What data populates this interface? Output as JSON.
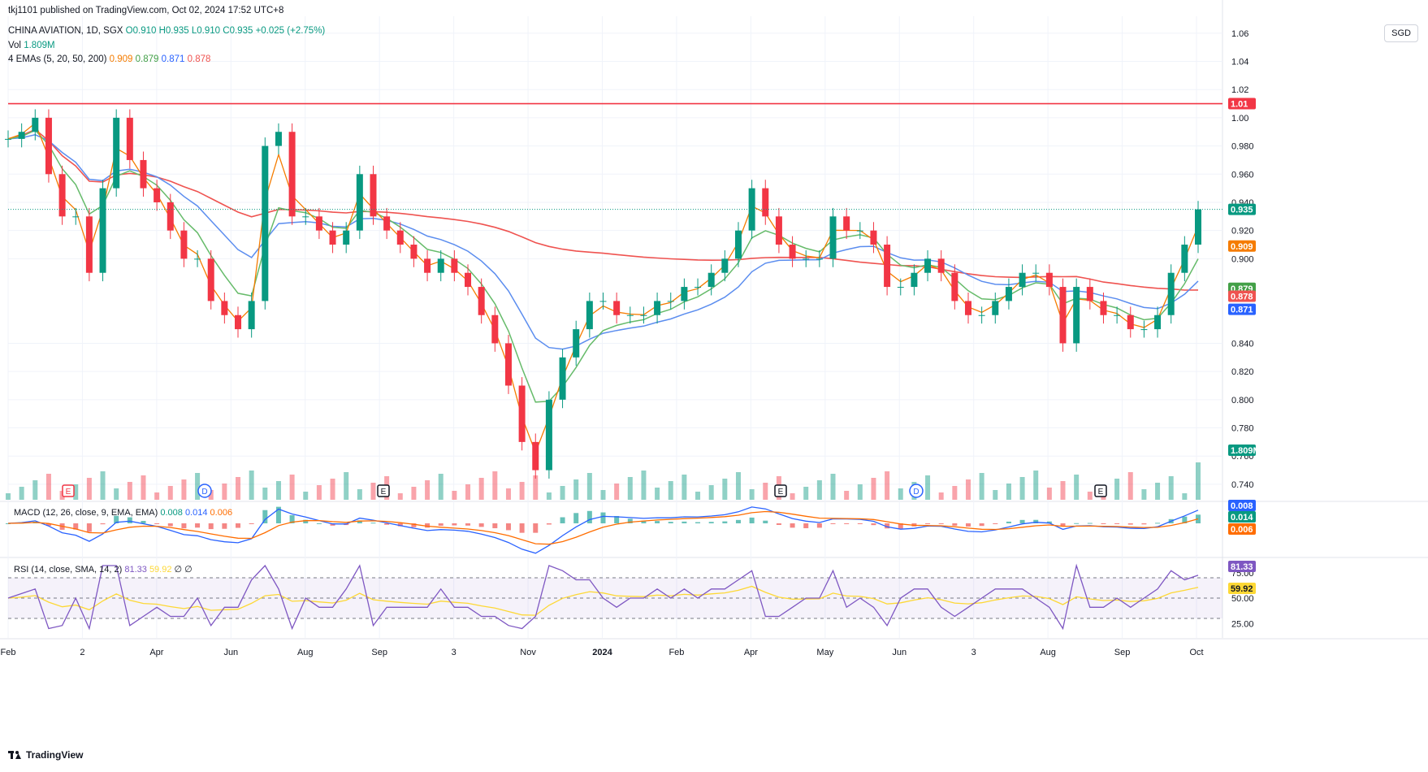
{
  "publisher": "tkj1101 published on TradingView.com, Oct 02, 2024 17:52 UTC+8",
  "currency": "SGD",
  "brand": "TradingView",
  "symbol_line": {
    "symbol": "CHINA AVIATION, 1D, SGX",
    "o": "O0.910",
    "h": "H0.935",
    "l": "L0.910",
    "c": "C0.935",
    "chg": "+0.025 (+2.75%)"
  },
  "vol_line": {
    "label": "Vol",
    "value": "1.809M"
  },
  "ema_line": {
    "label": "4 EMAs (5, 20, 50, 200)",
    "v1": "0.909",
    "v2": "0.879",
    "v3": "0.871",
    "v4": "0.878"
  },
  "macd_line": {
    "label": "MACD (12, 26, close, 9, EMA, EMA)",
    "v1": "0.008",
    "v2": "0.014",
    "v3": "0.006"
  },
  "rsi_line": {
    "label": "RSI (14, close, SMA, 14, 2)",
    "v1": "81.33",
    "v2": "59.92",
    "v3": "∅ ∅"
  },
  "colors": {
    "up": "#089981",
    "down": "#f23645",
    "ema5": "#f57c00",
    "ema20": "#66bb6a",
    "ema50": "#5b8def",
    "ema200": "#ef5350",
    "macd": "#2962ff",
    "signal": "#ff6d00",
    "rsi": "#7e57c2",
    "rsi_ma": "#fdd835",
    "hline": "#f23645"
  },
  "chart_data": {
    "type": "candlestick",
    "y_ticks": [
      "1.06",
      "1.04",
      "1.02",
      "1.00",
      "0.980",
      "0.960",
      "0.940",
      "0.920",
      "0.900",
      "0.840",
      "0.820",
      "0.800",
      "0.780",
      "0.760",
      "0.740"
    ],
    "ylim": [
      0.729,
      1.072
    ],
    "x_ticks": [
      "Feb",
      "2",
      "Apr",
      "Jun",
      "Aug",
      "Sep",
      "3",
      "Nov",
      "2024",
      "Feb",
      "Apr",
      "May",
      "Jun",
      "3",
      "Aug",
      "Sep",
      "Oct"
    ],
    "horizontal_line": {
      "value": 1.01,
      "label": "1.01"
    },
    "last_price": {
      "value": 0.935,
      "label": "0.935"
    },
    "price_labels": [
      {
        "value": 0.909,
        "label": "0.909",
        "color": "#f57c00"
      },
      {
        "value": 0.879,
        "label": "0.879",
        "color": "#43a047"
      },
      {
        "value": 0.878,
        "label": "0.878",
        "color": "#ef5350"
      },
      {
        "value": 0.871,
        "label": "0.871",
        "color": "#2962ff"
      }
    ],
    "volume_label": "1.809M",
    "events": [
      {
        "x": "Feb",
        "letter": "E",
        "color": "#f23645"
      },
      {
        "x": "Apr",
        "letter": "D",
        "color": "#2962ff"
      },
      {
        "x": "Aug",
        "letter": "E",
        "color": "#131722"
      },
      {
        "x": "Feb",
        "letter": "E",
        "color": "#131722"
      },
      {
        "x": "May",
        "letter": "D",
        "color": "#2962ff"
      },
      {
        "x": "Aug",
        "letter": "E",
        "color": "#131722"
      }
    ],
    "close_series": [
      0.985,
      0.99,
      1.0,
      0.96,
      0.93,
      0.93,
      0.89,
      0.95,
      1.0,
      0.97,
      0.95,
      0.94,
      0.92,
      0.9,
      0.9,
      0.87,
      0.86,
      0.85,
      0.87,
      0.98,
      0.99,
      0.93,
      0.93,
      0.92,
      0.91,
      0.92,
      0.96,
      0.93,
      0.92,
      0.91,
      0.9,
      0.89,
      0.9,
      0.89,
      0.88,
      0.86,
      0.84,
      0.81,
      0.77,
      0.75,
      0.8,
      0.83,
      0.85,
      0.87,
      0.87,
      0.86,
      0.86,
      0.86,
      0.87,
      0.87,
      0.88,
      0.88,
      0.89,
      0.9,
      0.92,
      0.95,
      0.93,
      0.91,
      0.9,
      0.9,
      0.9,
      0.93,
      0.92,
      0.92,
      0.91,
      0.88,
      0.88,
      0.89,
      0.9,
      0.89,
      0.87,
      0.86,
      0.86,
      0.87,
      0.88,
      0.89,
      0.89,
      0.88,
      0.84,
      0.88,
      0.87,
      0.86,
      0.86,
      0.85,
      0.85,
      0.86,
      0.89,
      0.91,
      0.935
    ],
    "macd": {
      "value": "0.008",
      "signal": "0.014",
      "hist": "0.006"
    },
    "rsi": {
      "value": "81.33",
      "ma": "59.92",
      "ticks": [
        "75.00",
        "50.00",
        "25.00"
      ],
      "levels": [
        70,
        50,
        30
      ]
    }
  }
}
